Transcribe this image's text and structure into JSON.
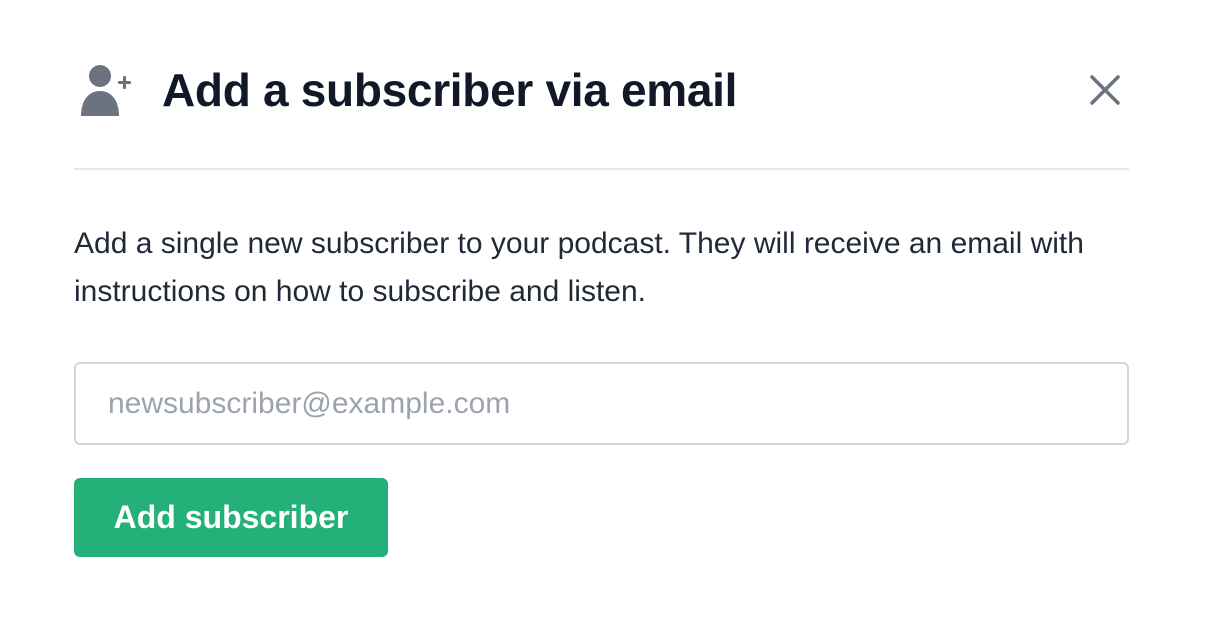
{
  "dialog": {
    "title": "Add a subscriber via email",
    "header_icon": "user-plus-icon",
    "close_icon": "close-icon",
    "description": "Add a single new subscriber to your podcast. They will receive an email with instructions on how to subscribe and listen."
  },
  "form": {
    "email_placeholder": "newsubscriber@example.com",
    "email_value": "",
    "submit_label": "Add subscriber"
  },
  "colors": {
    "accent": "#25b07a",
    "title_text": "#111827",
    "icon": "#6b7280",
    "divider": "#e5e7eb",
    "input_border": "#d1d5db",
    "placeholder": "#9ca3af"
  }
}
